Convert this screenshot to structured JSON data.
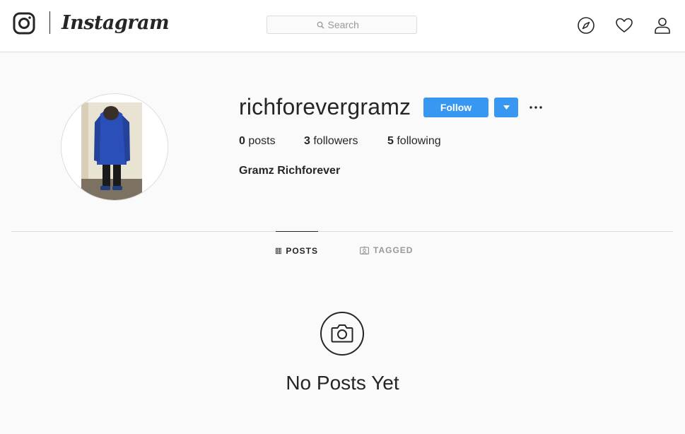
{
  "nav": {
    "brand": "Instagram",
    "search": {
      "placeholder": "Search",
      "value": ""
    },
    "icons": [
      "instagram-glyph-icon",
      "compass-icon",
      "heart-icon",
      "user-icon"
    ]
  },
  "profile": {
    "username": "richforevergramz",
    "full_name": "Gramz Richforever",
    "follow_label": "Follow",
    "stats": {
      "posts_count": "0",
      "posts_label": "posts",
      "followers_count": "3",
      "followers_label": "followers",
      "following_count": "5",
      "following_label": "following"
    }
  },
  "tabs": [
    {
      "label": "POSTS",
      "icon": "grid-icon",
      "active": true
    },
    {
      "label": "TAGGED",
      "icon": "tagged-icon",
      "active": false
    }
  ],
  "empty_state": {
    "icon": "camera-icon",
    "text": "No Posts Yet"
  },
  "colors": {
    "accent": "#3897f0",
    "text": "#262626",
    "muted": "#999999",
    "border": "#dbdbdb",
    "background": "#fafafa"
  }
}
